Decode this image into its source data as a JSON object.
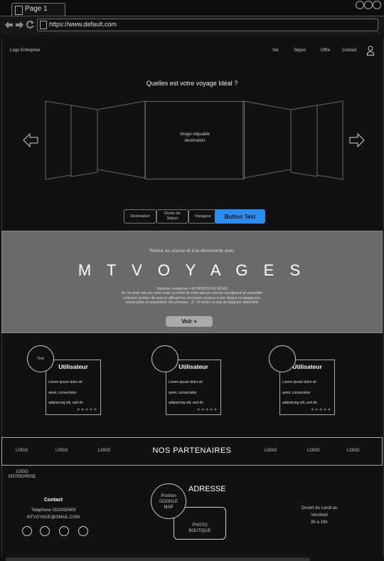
{
  "browser": {
    "tab_label": "Page 1",
    "url": "https://www.default.com",
    "nav_icons": [
      "back-arrow-icon",
      "forward-arrow-icon",
      "refresh-icon"
    ]
  },
  "header": {
    "logo": "Logo Entreprise",
    "nav": [
      "Vol",
      "Séjour",
      "Offre",
      "Contact"
    ]
  },
  "hero": {
    "question": "Quelles est votre voyage Idéal ?",
    "center_card_line1": "Image cliquable",
    "center_card_line2": "destination"
  },
  "filters": {
    "destination": "Destination",
    "duree_line1": "Durée du",
    "duree_line2": "Séjour",
    "voyageur": "Voyageur",
    "button": "Button Text"
  },
  "about": {
    "subtitle": "Retour au source et à la découverte avec",
    "brand": "M T   V O Y A G E S",
    "desc_line1": "Résumer entreprise = A PROPOS DE NOUS",
    "desc_line2": "Un Un texte est une série orale ou écrite de mots perçus comme constituant un ensemble",
    "desc_line3": "cohérent, porteur de sens et utilisant les structures propres à une langue (conjugaisons,",
    "desc_line4": "construction et association des phrases…)1. Un texte n'a pas de longueur déterminé",
    "button": "Voir +"
  },
  "testimonials": {
    "avatar_text": "Text",
    "name": "Utilisateur",
    "line1": "Lorem ipsum dolor sit",
    "line2": "amet, consectetur",
    "line3": "adipisicing elit, sed do",
    "stars": "★★★★★"
  },
  "partners": {
    "title": "NOS PARTENAIRES",
    "logo": "LOGO"
  },
  "footer": {
    "logo_line1": "LOGO",
    "logo_line2": "ENTREPRISE",
    "contact_title": "Contact",
    "phone": "Telephone 0102030405",
    "email": "MTVOYAGE@GMAIL.COM",
    "address_title": "ADRESSE",
    "map_line1": "Position",
    "map_line2": "GOOGLE",
    "map_line3": "MAP",
    "photo_line1": "PHOTO",
    "photo_line2": "BOUTIQUE",
    "hours_line1": "Ouvert du Lundi au",
    "hours_line2": "Vendredi",
    "hours_line3": "8h à 18h"
  },
  "colors": {
    "accent": "#2d8cf0",
    "band": "#6a6a6a",
    "background": "#111111"
  }
}
